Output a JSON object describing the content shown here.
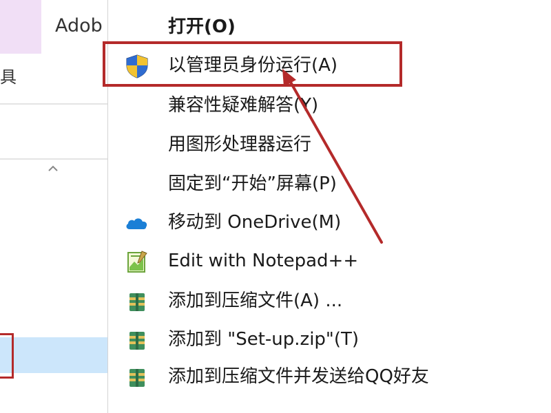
{
  "background": {
    "header_label": "Adob",
    "side_label": "具"
  },
  "context_menu": {
    "items": [
      {
        "label": "打开(O)",
        "icon": ""
      },
      {
        "label": "以管理员身份运行(A)",
        "icon": "uac-shield-icon"
      },
      {
        "label": "兼容性疑难解答(Y)",
        "icon": ""
      },
      {
        "label": "用图形处理器运行",
        "icon": ""
      },
      {
        "label": "固定到“开始”屏幕(P)",
        "icon": ""
      },
      {
        "label": "移动到 OneDrive(M)",
        "icon": "onedrive-cloud-icon"
      },
      {
        "label": "Edit with Notepad++",
        "icon": "notepad-plus-plus-icon"
      },
      {
        "label": "添加到压缩文件(A) ...",
        "icon": "archive-icon"
      },
      {
        "label": "添加到 \"Set-up.zip\"(T)",
        "icon": "archive-icon"
      },
      {
        "label": "添加到压缩文件并发送给QQ好友",
        "icon": "archive-icon"
      }
    ]
  },
  "colors": {
    "annotation_red": "#b42a2a",
    "selection_blue": "#cce6fb",
    "tile_purple": "#f1dff6",
    "onedrive_blue": "#1b7fd6"
  }
}
